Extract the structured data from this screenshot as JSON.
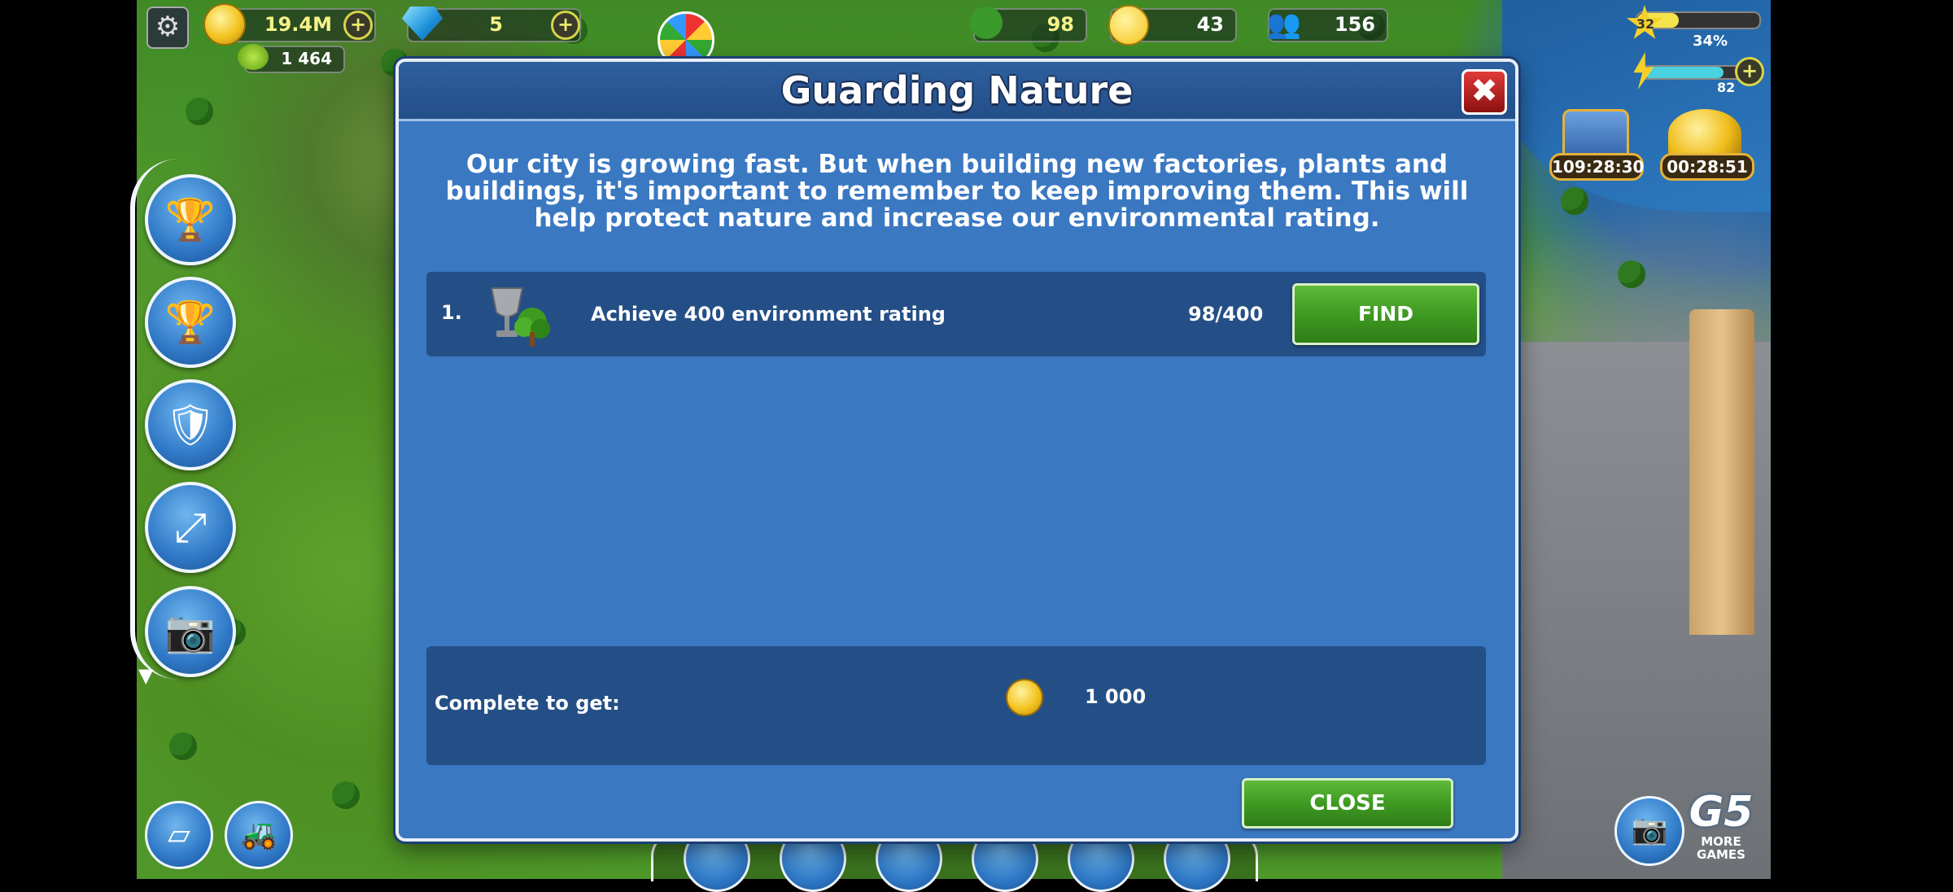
{
  "hud": {
    "coins": "19.4M",
    "green_cash": "1 464",
    "gems": "5",
    "environment": "98",
    "happiness": "43",
    "population": "156",
    "level": "32",
    "level_percent": "34%",
    "energy": "82",
    "chest_timer": "109:28:30",
    "coins_timer": "00:28:51",
    "plus": "+"
  },
  "dialog": {
    "title": "Guarding Nature",
    "close_x": "✖",
    "description": "Our city is growing fast. But when building new factories, plants and buildings, it's important to remember to keep improving them. This will help protect nature and increase our environmental rating.",
    "quest": {
      "number": "1.",
      "text": "Achieve 400 environment rating",
      "progress": "98/400",
      "find_label": "FIND"
    },
    "reward": {
      "label": "Complete to get:",
      "amount": "1 000"
    },
    "close_label": "CLOSE"
  },
  "brand": {
    "logo": "G5",
    "more_games": "MORE GAMES"
  },
  "icons": {
    "settings": "gear-icon",
    "coin": "coin-icon",
    "gem": "gem-icon",
    "tree": "tree-icon",
    "smile": "smile-icon",
    "people": "people-icon",
    "star": "star-icon",
    "lightning": "lightning-icon"
  },
  "colors": {
    "dialog_bg": "#3a78c2",
    "row_bg": "#244f86",
    "button_green": "#3f9a22",
    "close_red": "#c62525"
  }
}
